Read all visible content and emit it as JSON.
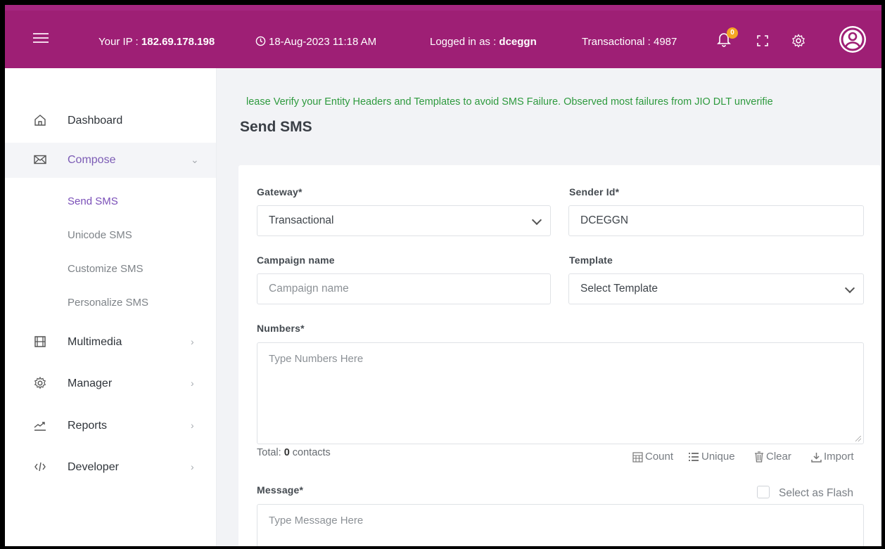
{
  "topbar": {
    "ip_label": "Your IP : ",
    "ip_value": "182.69.178.198",
    "datetime": "18-Aug-2023 11:18 AM",
    "user_label": "Logged in as : ",
    "user_value": "dceggn",
    "transactional": "Transactional : 4987",
    "notification_count": "0",
    "bg_color": "#9e1f75"
  },
  "sidebar": {
    "items": [
      {
        "label": "Dashboard",
        "icon": "home-icon"
      },
      {
        "label": "Compose",
        "icon": "envelope-icon"
      },
      {
        "label": "Multimedia",
        "icon": "film-icon"
      },
      {
        "label": "Manager",
        "icon": "gear-icon"
      },
      {
        "label": "Reports",
        "icon": "chart-line-icon"
      },
      {
        "label": "Developer",
        "icon": "code-icon"
      }
    ],
    "compose_sub": [
      "Send SMS",
      "Unicode SMS",
      "Customize SMS",
      "Personalize SMS"
    ]
  },
  "main": {
    "notice": "lease Verify your Entity Headers and Templates to avoid SMS Failure. Observed most failures from JIO DLT unverifie",
    "title": "Send SMS",
    "form": {
      "gateway_label": "Gateway*",
      "gateway_value": "Transactional",
      "sender_label": "Sender Id*",
      "sender_value": "DCEGGN",
      "campaign_label": "Campaign name",
      "campaign_placeholder": "Campaign name",
      "template_label": "Template",
      "template_value": "Select Template",
      "numbers_label": "Numbers*",
      "numbers_placeholder": "Type Numbers Here",
      "total_prefix": "Total: ",
      "total_count": "0",
      "total_suffix": " contacts",
      "tools": {
        "count": "Count",
        "unique": "Unique",
        "clear": "Clear",
        "import": "Import"
      },
      "message_label": "Message*",
      "flash_label": "Select as Flash",
      "message_placeholder": "Type Message Here"
    }
  }
}
